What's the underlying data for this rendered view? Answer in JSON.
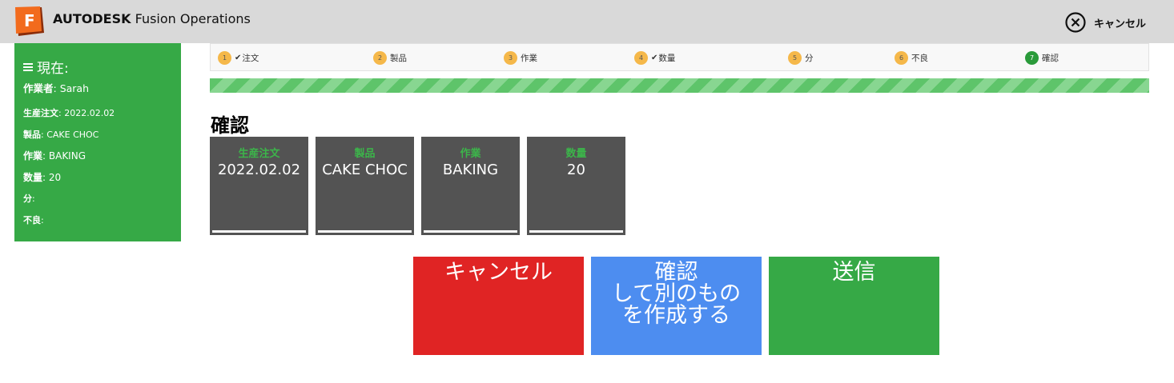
{
  "header": {
    "brand_bold": "AUTODESK",
    "brand_rest": "Fusion Operations",
    "cancel_label": "キャンセル"
  },
  "sidebar": {
    "title": "現在:",
    "rows": [
      {
        "key": "作業者",
        "value": "Sarah"
      },
      {
        "key": "生産注文",
        "value": "2022.02.02"
      },
      {
        "key": "製品",
        "value": "CAKE CHOC"
      },
      {
        "key": "作業",
        "value": "BAKING"
      },
      {
        "key": "数量",
        "value": "20"
      },
      {
        "key": "分",
        "value": ""
      },
      {
        "key": "不良",
        "value": ""
      }
    ]
  },
  "steps": [
    {
      "num": "1",
      "check": "✔",
      "label": "注文"
    },
    {
      "num": "2",
      "check": "",
      "label": "製品"
    },
    {
      "num": "3",
      "check": "",
      "label": "作業"
    },
    {
      "num": "4",
      "check": "✔",
      "label": "数量"
    },
    {
      "num": "5",
      "check": "",
      "label": "分"
    },
    {
      "num": "6",
      "check": "",
      "label": "不良"
    },
    {
      "num": "7",
      "check": "",
      "label": "確認"
    }
  ],
  "main": {
    "heading": "確認",
    "cards": [
      {
        "key": "生産注文",
        "value": "2022.02.02"
      },
      {
        "key": "製品",
        "value": "CAKE CHOC"
      },
      {
        "key": "作業",
        "value": "BAKING"
      },
      {
        "key": "数量",
        "value": "20"
      }
    ]
  },
  "buttons": {
    "cancel_label": "キャンセル",
    "confirm_line1": "確認",
    "confirm_line2": "して別のもの",
    "confirm_line3": "を作成する",
    "submit_label": "送信"
  },
  "colors": {
    "accent_green": "#36a946",
    "cancel_red": "#e02424",
    "confirm_blue": "#4d8df0",
    "step_orange": "#f5b84a"
  }
}
